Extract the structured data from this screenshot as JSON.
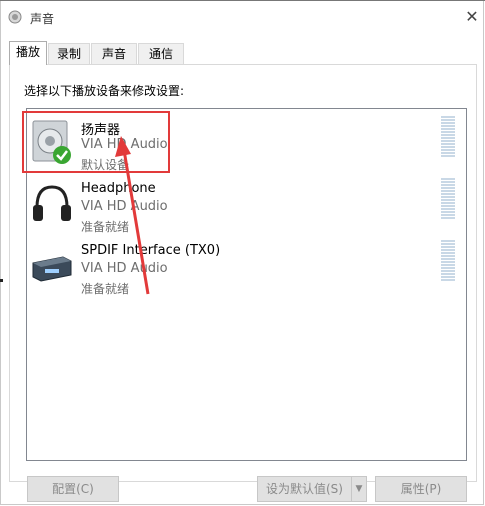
{
  "window": {
    "title": "声音"
  },
  "tabs": [
    {
      "label": "播放",
      "active": true
    },
    {
      "label": "录制",
      "active": false
    },
    {
      "label": "声音",
      "active": false
    },
    {
      "label": "通信",
      "active": false
    }
  ],
  "instruction": "选择以下播放设备来修改设置:",
  "devices": [
    {
      "name": "扬声器",
      "driver": "VIA HD Audio",
      "status": "默认设备",
      "icon": "speaker-icon",
      "is_default": true
    },
    {
      "name": "Headphone",
      "driver": "VIA HD Audio",
      "status": "准备就绪",
      "icon": "headphone-icon",
      "is_default": false
    },
    {
      "name": "SPDIF Interface (TX0)",
      "driver": "VIA HD Audio",
      "status": "准备就绪",
      "icon": "spdif-icon",
      "is_default": false
    }
  ],
  "buttons": {
    "configure": "配置(C)",
    "set_default": "设为默认值(S)",
    "properties": "属性(P)"
  },
  "colors": {
    "annotation": "#e23a3a",
    "default_check": "#3aa632"
  }
}
